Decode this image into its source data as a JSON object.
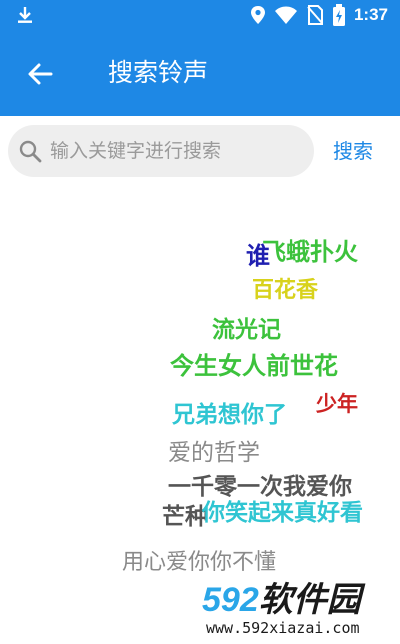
{
  "status_bar": {
    "time": "1:37",
    "icons": [
      "download-icon",
      "location-icon",
      "wifi-icon",
      "no-sim-icon",
      "battery-charging-icon"
    ]
  },
  "app_bar": {
    "back_icon": "arrow-back-icon",
    "title": "搜索铃声"
  },
  "search": {
    "placeholder": "输入关键字进行搜索",
    "value": "",
    "button_label": "搜索"
  },
  "tag_cloud": [
    {
      "text": "谁",
      "color": "#1f1fb0"
    },
    {
      "text": "飞蛾扑火",
      "color": "#3cc23c"
    },
    {
      "text": "百花香",
      "color": "#d8d21c"
    },
    {
      "text": "流光记",
      "color": "#3cc23c"
    },
    {
      "text": "今生女人前世花",
      "color": "#3cc23c"
    },
    {
      "text": "少年",
      "color": "#cc2222"
    },
    {
      "text": "兄弟想你了",
      "color": "#2fc5d2"
    },
    {
      "text": "爱的哲学",
      "color": "#8a8a8a"
    },
    {
      "text": "一千零一次我爱你",
      "color": "#555555"
    },
    {
      "text": "芒种",
      "color": "#555555"
    },
    {
      "text": "你笑起来真好看",
      "color": "#2fc5d2"
    },
    {
      "text": "用心爱你你不懂",
      "color": "#8a8a8a"
    }
  ],
  "watermark": {
    "brand_number": "592",
    "brand_text": "软件园",
    "url": "www.592xiazai.com",
    "number_color": "#2aa6e8",
    "text_color": "#1a1a1a"
  },
  "colors": {
    "primary": "#1e88e5",
    "search_bg": "#eeeeee"
  }
}
